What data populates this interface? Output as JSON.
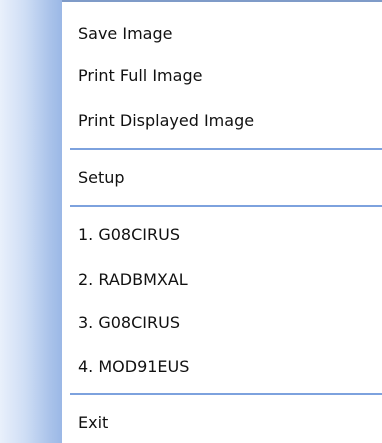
{
  "menu": {
    "items": [
      {
        "label": "Save Image"
      },
      {
        "label": "Print Full Image"
      },
      {
        "label": "Print Displayed Image"
      },
      {
        "label": "Setup"
      },
      {
        "label": "1. G08CIRUS"
      },
      {
        "label": "2. RADBMXAL"
      },
      {
        "label": "3. G08CIRUS"
      },
      {
        "label": "4. MOD91EUS"
      },
      {
        "label": "Exit"
      }
    ]
  },
  "colors": {
    "gutter_dark": "#9bb8e6",
    "gutter_light": "#e9f0fb",
    "separator": "#7da2de"
  }
}
